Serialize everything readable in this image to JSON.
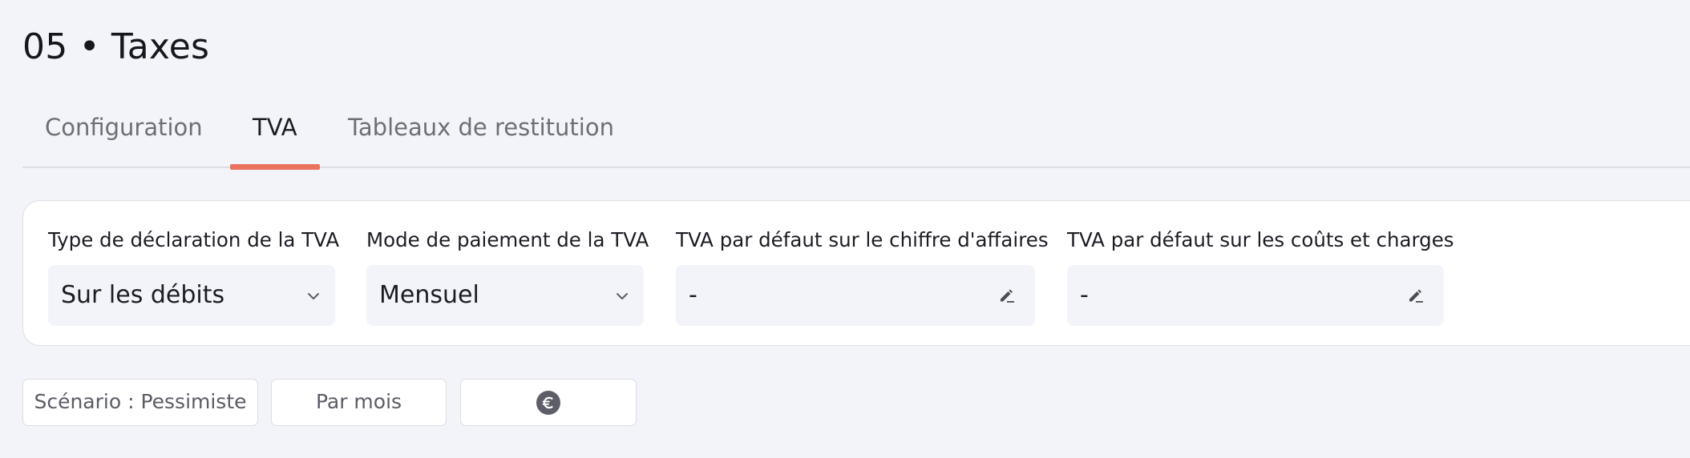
{
  "page": {
    "title": "05 • Taxes"
  },
  "tabs": [
    {
      "label": "Configuration",
      "active": false
    },
    {
      "label": "TVA",
      "active": true
    },
    {
      "label": "Tableaux de restitution",
      "active": false
    }
  ],
  "fields": {
    "declaration_type": {
      "label": "Type de déclaration de la TVA",
      "value": "Sur les débits",
      "icon": "chevron-down-icon"
    },
    "payment_mode": {
      "label": "Mode de paiement de la TVA",
      "value": "Mensuel",
      "icon": "chevron-down-icon"
    },
    "default_vat_revenue": {
      "label": "TVA par défaut sur le chiffre d'affaires",
      "value": "-",
      "icon": "edit-icon"
    },
    "default_vat_costs": {
      "label": "TVA par défaut sur les coûts et charges",
      "value": "-",
      "icon": "edit-icon"
    }
  },
  "filters": {
    "scenario_label": "Scénario : Pessimiste",
    "period_label": "Par mois",
    "currency_icon": "euro-icon"
  },
  "colors": {
    "accent": "#e9735d",
    "background": "#f3f4f9",
    "card": "#ffffff",
    "border": "#dcdde4"
  }
}
